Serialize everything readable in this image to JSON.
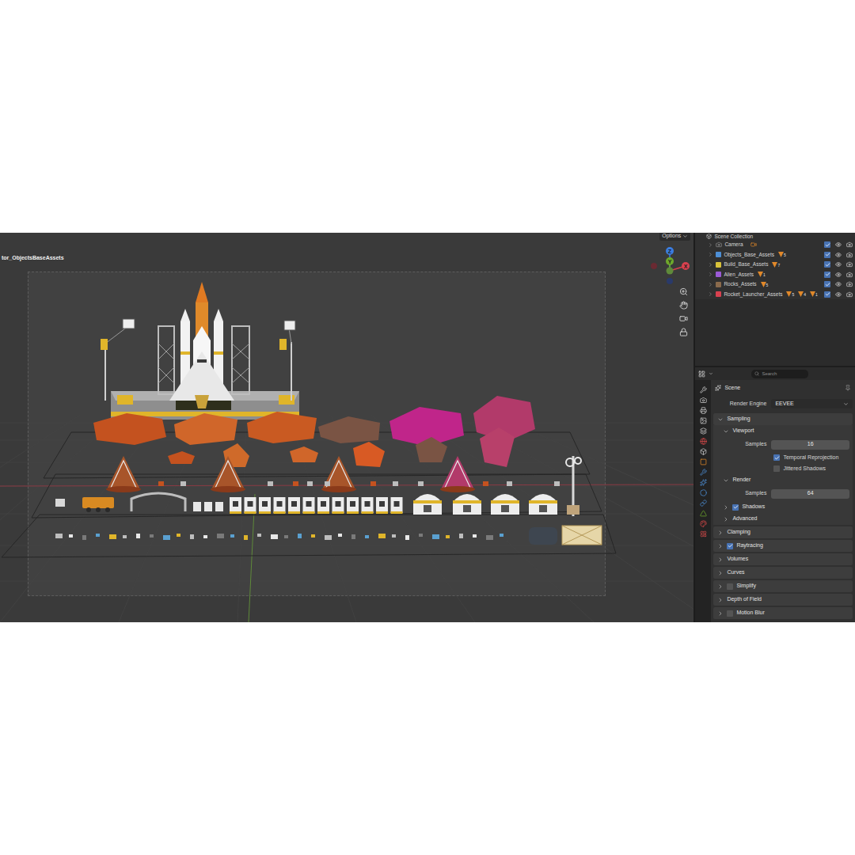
{
  "viewport": {
    "file_label": "tor_ObjectsBaseAssets",
    "options": "Options",
    "gizmo_axes": [
      {
        "label": "Z",
        "color": "#3b7de0"
      },
      {
        "label": "Y",
        "color": "#6ea82c"
      },
      {
        "label": "X",
        "color": "#d9414f"
      }
    ]
  },
  "outliner": {
    "root": "Scene Collection",
    "items": [
      {
        "name": "Camera",
        "kind": "object",
        "color": "#9a9a9a",
        "badges": [],
        "selectable": true,
        "visible": true,
        "renderable": true
      },
      {
        "name": "Objects_Base_Assets",
        "kind": "collection",
        "color": "#4d8fd6",
        "badges": [
          "5"
        ],
        "selectable": true,
        "visible": true,
        "renderable": true
      },
      {
        "name": "Build_Base_Assets",
        "kind": "collection",
        "color": "#d8c23a",
        "badges": [
          "7"
        ],
        "selectable": true,
        "visible": true,
        "renderable": true
      },
      {
        "name": "Alien_Assets",
        "kind": "collection",
        "color": "#9a5ad6",
        "badges": [
          "1"
        ],
        "selectable": true,
        "visible": true,
        "renderable": true
      },
      {
        "name": "Rocks_Assets",
        "kind": "collection",
        "color": "#8a6a4c",
        "badges": [
          "5"
        ],
        "selectable": true,
        "visible": true,
        "renderable": true
      },
      {
        "name": "Rocket_Launcher_Assets",
        "kind": "collection",
        "color": "#d8414f",
        "badges": [
          "5",
          "4",
          "1"
        ],
        "selectable": true,
        "visible": true,
        "renderable": true
      }
    ]
  },
  "properties": {
    "search": {
      "placeholder": "Search"
    },
    "context": "Scene",
    "render_engine": {
      "label": "Render Engine",
      "value": "EEVEE"
    },
    "rows": [
      {
        "kind": "section",
        "label": "Sampling",
        "expanded": true
      },
      {
        "kind": "subsection",
        "label": "Viewport",
        "expanded": true
      },
      {
        "kind": "field",
        "label": "Samples",
        "value": "16"
      },
      {
        "kind": "checkbox",
        "label": "Temporal Reprojection",
        "checked": true
      },
      {
        "kind": "checkbox",
        "label": "Jittered Shadows",
        "checked": false
      },
      {
        "kind": "subsection",
        "label": "Render",
        "expanded": true
      },
      {
        "kind": "field",
        "label": "Samples",
        "value": "64"
      },
      {
        "kind": "subsection",
        "label": "Shadows",
        "expanded": false,
        "checked": true
      },
      {
        "kind": "subsection",
        "label": "Advanced",
        "expanded": false
      },
      {
        "kind": "section",
        "label": "Clamping",
        "expanded": false
      },
      {
        "kind": "section",
        "label": "Raytracing",
        "expanded": false,
        "checked": true
      },
      {
        "kind": "section",
        "label": "Volumes",
        "expanded": false
      },
      {
        "kind": "section",
        "label": "Curves",
        "expanded": false
      },
      {
        "kind": "section",
        "label": "Simplify",
        "expanded": false,
        "checked": false
      },
      {
        "kind": "section",
        "label": "Depth of Field",
        "expanded": false
      },
      {
        "kind": "section",
        "label": "Motion Blur",
        "expanded": false,
        "checked": false
      }
    ]
  }
}
